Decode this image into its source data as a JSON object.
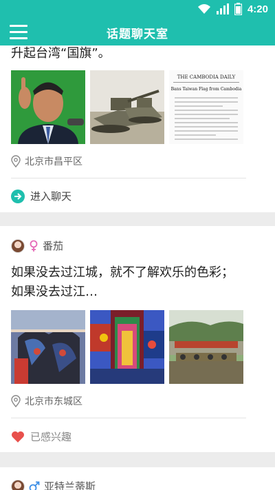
{
  "status_bar": {
    "time": "4:20"
  },
  "app_bar": {
    "title": "话题聊天室"
  },
  "posts": [
    {
      "snippet": "升起台湾“国旗”。",
      "location": "北京市昌平区",
      "action_label": "进入聊天",
      "news_headline_masthead": "THE CAMBODIA DAILY",
      "news_headline": "Bans Taiwan Flag from Cambodia"
    },
    {
      "user_name": "番茄",
      "user_gender": "female",
      "snippet_line1": "如果没去过江城，就不了解欢乐的色彩；",
      "snippet_line2": "如果没去过江…",
      "location": "北京市东城区",
      "action_label": "已感兴趣"
    },
    {
      "user_name": "亚特兰蒂斯",
      "user_gender": "male"
    }
  ],
  "colors": {
    "accent": "#1fbfae",
    "heart": "#e8504c",
    "female": "#e56bb8",
    "male": "#3c8ee6"
  }
}
